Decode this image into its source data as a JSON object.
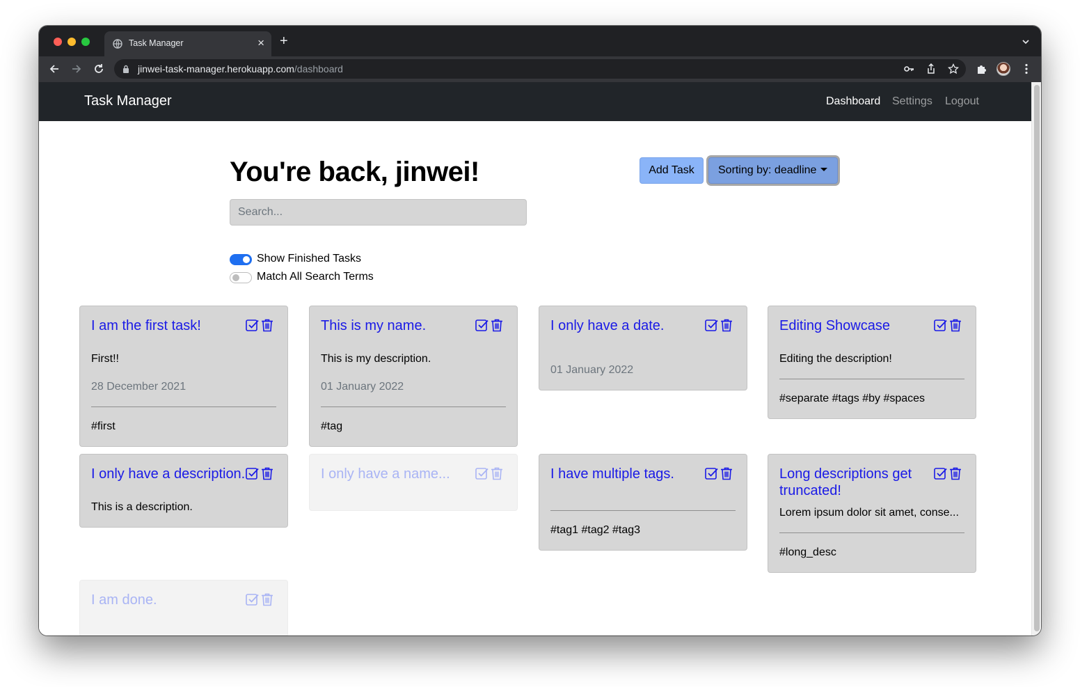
{
  "browser": {
    "tab_title": "Task Manager",
    "url_host": "jinwei-task-manager.herokuapp.com",
    "url_path": "/dashboard"
  },
  "navbar": {
    "brand": "Task Manager",
    "links": [
      "Dashboard",
      "Settings",
      "Logout"
    ],
    "active": "Dashboard"
  },
  "greeting": "You're back, jinwei!",
  "actions": {
    "add_task": "Add Task",
    "sort": "Sorting by: deadline"
  },
  "search": {
    "placeholder": "Search...",
    "value": ""
  },
  "toggles": {
    "show_finished": {
      "label": "Show Finished Tasks",
      "on": true
    },
    "match_all": {
      "label": "Match All Search Terms",
      "on": false
    }
  },
  "tasks": [
    {
      "title": "I am the first task!",
      "description": "First!!",
      "date": "28 December 2021",
      "tags": "#first",
      "done": false
    },
    {
      "title": "This is my name.",
      "description": "This is my description.",
      "date": "01 January 2022",
      "tags": "#tag",
      "done": false
    },
    {
      "title": "I only have a date.",
      "description": "",
      "date": "01 January 2022",
      "tags": "",
      "done": false
    },
    {
      "title": "Editing Showcase",
      "description": "Editing the description!",
      "date": "",
      "tags": "#separate #tags #by #spaces",
      "done": false
    },
    {
      "title": "I only have a description.",
      "description": "This is a description.",
      "date": "",
      "tags": "",
      "done": false
    },
    {
      "title": "I only have a name...",
      "description": "",
      "date": "",
      "tags": "",
      "done": true
    },
    {
      "title": "I have multiple tags.",
      "description": "",
      "date": "",
      "tags": "#tag1 #tag2 #tag3",
      "done": false
    },
    {
      "title": "Long descriptions get truncated!",
      "description": "Lorem ipsum dolor sit amet, conse...",
      "date": "",
      "tags": "#long_desc",
      "done": false
    },
    {
      "title": "I am done.",
      "description": "",
      "date": "",
      "tags": "",
      "done": true
    }
  ],
  "colors": {
    "accent": "#1f6ff0",
    "task_title": "#1a1ae6",
    "done_title": "#a9b4f4",
    "card_bg": "#d6d6d6",
    "navbar_bg": "#212529"
  }
}
